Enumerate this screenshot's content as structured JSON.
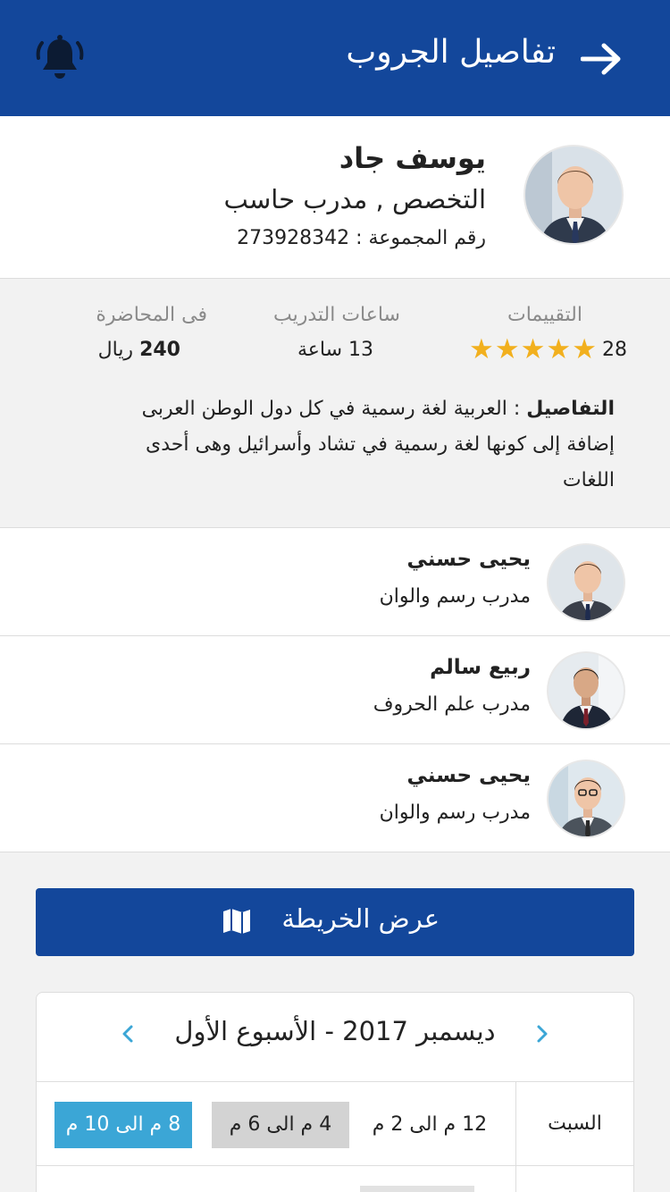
{
  "header": {
    "title": "تفاصيل الجروب",
    "colors": {
      "primary": "#13479b",
      "accent": "#3ba6d6",
      "star": "#f2b01e"
    }
  },
  "profile": {
    "name": "يوسف جاد",
    "specialty": "التخصص , مدرب حاسب",
    "group_number": "رقم المجموعة : 273928342"
  },
  "stats": {
    "ratings_label": "التقييمات",
    "ratings_count": "28",
    "stars": 5,
    "hours_label": "ساعات التدريب",
    "hours_value": "13 ساعة",
    "lecture_label": "فى المحاضرة",
    "lecture_price": "240",
    "lecture_currency": "ريال"
  },
  "details": {
    "label": "التفاصيل",
    "text": " : العربية لغة رسمية في كل دول الوطن العربى إضافة إلى كونها لغة رسمية في تشاد وأسرائيل وهى أحدى اللغات"
  },
  "trainers": [
    {
      "name": "يحيى حسني",
      "role": "مدرب رسم والوان"
    },
    {
      "name": "ربيع سالم",
      "role": "مدرب علم الحروف"
    },
    {
      "name": "يحيى حسني",
      "role": "مدرب رسم والوان"
    }
  ],
  "map_button": {
    "label": "عرض الخريطة",
    "icon": "map-icon"
  },
  "schedule": {
    "week_label": "ديسمبر 2017 - الأسبوع الأول",
    "day": "السبت",
    "slots": [
      "12 م الى 2 م",
      "4 م الى 6 م",
      "8 م الى 10 م"
    ]
  }
}
